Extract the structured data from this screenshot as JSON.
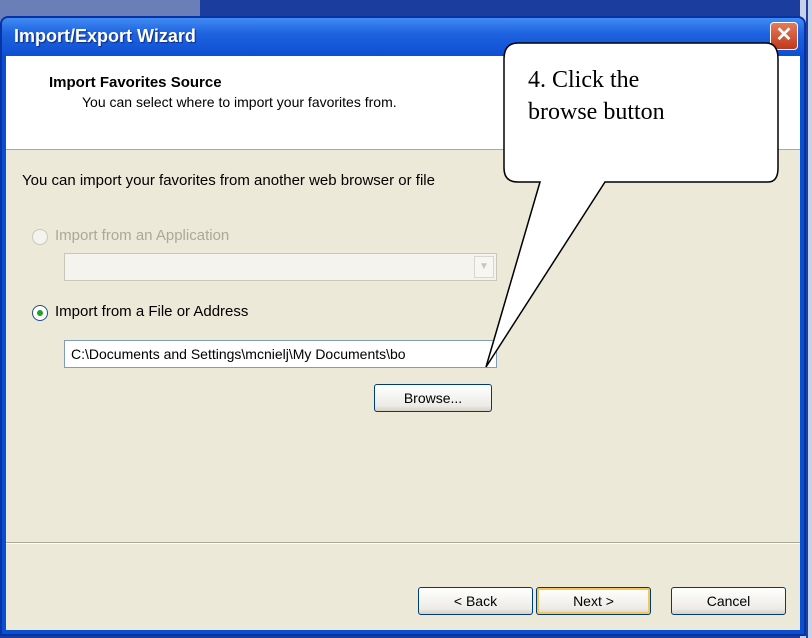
{
  "window": {
    "title": "Import/Export Wizard"
  },
  "header": {
    "title": "Import Favorites Source",
    "subtitle": "You can select where to import your favorites from."
  },
  "body": {
    "prompt": "You can import your favorites from another web browser or file"
  },
  "options": {
    "application": {
      "label": "Import from an Application",
      "selected": false,
      "enabled": false,
      "select_value": ""
    },
    "file": {
      "label": "Import from a File or Address",
      "selected": true,
      "value": "C:\\Documents and Settings\\mcnielj\\My Documents\\bo"
    }
  },
  "buttons": {
    "browse": "Browse...",
    "back": "< Back",
    "next": "Next >",
    "cancel": "Cancel"
  },
  "callout": {
    "line1": "4. Click the",
    "line2": "browse button"
  },
  "icons": {
    "close": "close-icon",
    "dropdown": "chevron-down-icon"
  },
  "colors": {
    "titlebar": "#0d4fd2",
    "dialog": "#ece9d8",
    "radio_selected": "#21a121",
    "close": "#c0391b"
  }
}
